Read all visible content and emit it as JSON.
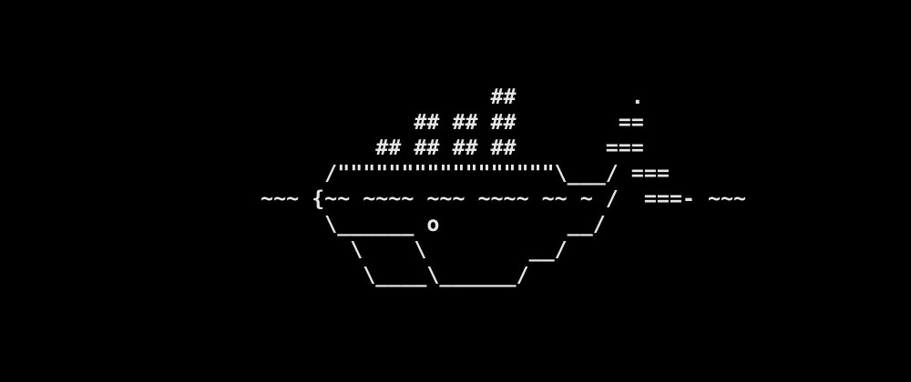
{
  "terminal": {
    "ascii_lines": [
      "                    ##         .",
      "              ## ## ##        ==",
      "           ## ## ## ##       ===",
      "       /\"\"\"\"\"\"\"\"\"\"\"\"\"\"\"\"\"\\___/ ===",
      "  ~~~ {~~ ~~~~ ~~~ ~~~~ ~~ ~ /  ===- ~~~",
      "       \\______ o          __/",
      "         \\    \\        __/",
      "          \\____\\______/"
    ],
    "text_color": "#e6e6e6",
    "background_color": "#000000"
  }
}
